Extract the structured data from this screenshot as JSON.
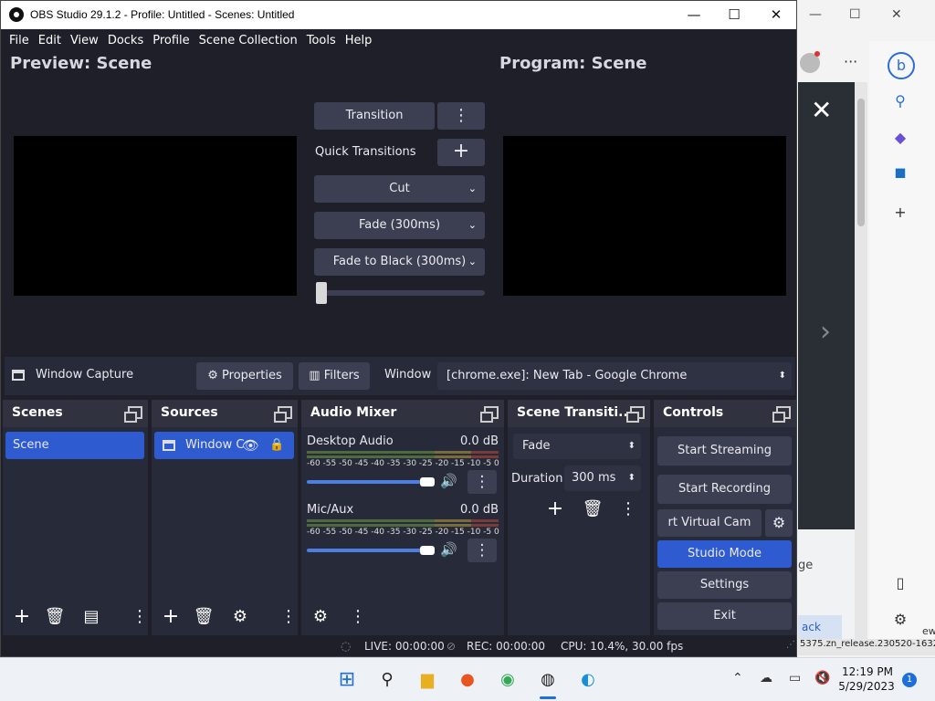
{
  "window": {
    "title": "OBS Studio 29.1.2 - Profile: Untitled - Scenes: Untitled"
  },
  "menu": [
    "File",
    "Edit",
    "View",
    "Docks",
    "Profile",
    "Scene Collection",
    "Tools",
    "Help"
  ],
  "preview": {
    "title": "Preview: Scene"
  },
  "program": {
    "title": "Program: Scene"
  },
  "transitions": {
    "transition_label": "Transition",
    "quick_label": "Quick Transitions",
    "items": [
      "Cut",
      "Fade (300ms)",
      "Fade to Black (300ms)"
    ]
  },
  "sourcebar": {
    "source_name": "Window Capture",
    "properties": "Properties",
    "filters": "Filters",
    "window_label": "Window",
    "window_value": "[chrome.exe]: New Tab - Google Chrome"
  },
  "scenes": {
    "title": "Scenes",
    "items": [
      "Scene"
    ]
  },
  "sources": {
    "title": "Sources",
    "items": [
      "Window C"
    ]
  },
  "audio": {
    "title": "Audio Mixer",
    "scale": "-60 -55 -50 -45 -40 -35 -30 -25 -20 -15 -10 -5  0",
    "channels": [
      {
        "name": "Desktop Audio",
        "db": "0.0 dB"
      },
      {
        "name": "Mic/Aux",
        "db": "0.0 dB"
      }
    ]
  },
  "scene_transitions": {
    "title": "Scene Transiti...",
    "type": "Fade",
    "duration_label": "Duration",
    "duration_value": "300 ms"
  },
  "controls": {
    "title": "Controls",
    "start_streaming": "Start Streaming",
    "start_recording": "Start Recording",
    "virtual_cam": "rt Virtual Cam",
    "studio_mode": "Studio Mode",
    "settings": "Settings",
    "exit": "Exit"
  },
  "status": {
    "live": "LIVE: 00:00:00",
    "rec": "REC: 00:00:00",
    "cpu": "CPU: 10.4%, 30.00 fps"
  },
  "bg_browser": {
    "status_text": "5375.zn_release.230520-1632",
    "button_text": "ack",
    "partial_text": "ge",
    "partial_text2": "ew"
  },
  "taskbar": {
    "time": "12:19 PM",
    "date": "5/29/2023",
    "notification_count": "1"
  },
  "colors": {
    "accent": "#2f5bd0",
    "panel": "#272a38",
    "background": "#1e1f29",
    "button": "#3b3f51"
  }
}
